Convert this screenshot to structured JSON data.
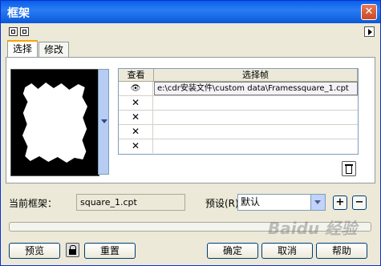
{
  "window": {
    "title": "框架",
    "close_glyph": "✕"
  },
  "tabs": [
    {
      "label": "选择",
      "active": true
    },
    {
      "label": "修改",
      "active": false
    }
  ],
  "grid": {
    "headers": [
      "查看",
      "选择帧"
    ],
    "rows": [
      {
        "view_icon": "eye-icon",
        "view": "👁",
        "file": "e:\\cdr安装文件\\custom data\\Framessquare_1.cpt",
        "selected": true
      },
      {
        "view_icon": "x-icon",
        "view": "✕",
        "file": ""
      },
      {
        "view_icon": "x-icon",
        "view": "✕",
        "file": ""
      },
      {
        "view_icon": "x-icon",
        "view": "✕",
        "file": ""
      },
      {
        "view_icon": "x-icon",
        "view": "✕",
        "file": ""
      }
    ]
  },
  "current_frame": {
    "label": "当前框架：",
    "value": "square_1.cpt"
  },
  "preset": {
    "label": "预设(R)",
    "value": "默认"
  },
  "preset_add": "+",
  "preset_remove": "−",
  "progress": {
    "value": 0
  },
  "buttons": {
    "preview": "预览",
    "reset": "重置",
    "ok": "确定",
    "cancel": "取消",
    "help": "帮助"
  },
  "watermark": "Baidu 经验",
  "colors": {
    "titlebar": "#0a5ee6",
    "face": "#ece9d8",
    "accent": "#f6a500"
  }
}
